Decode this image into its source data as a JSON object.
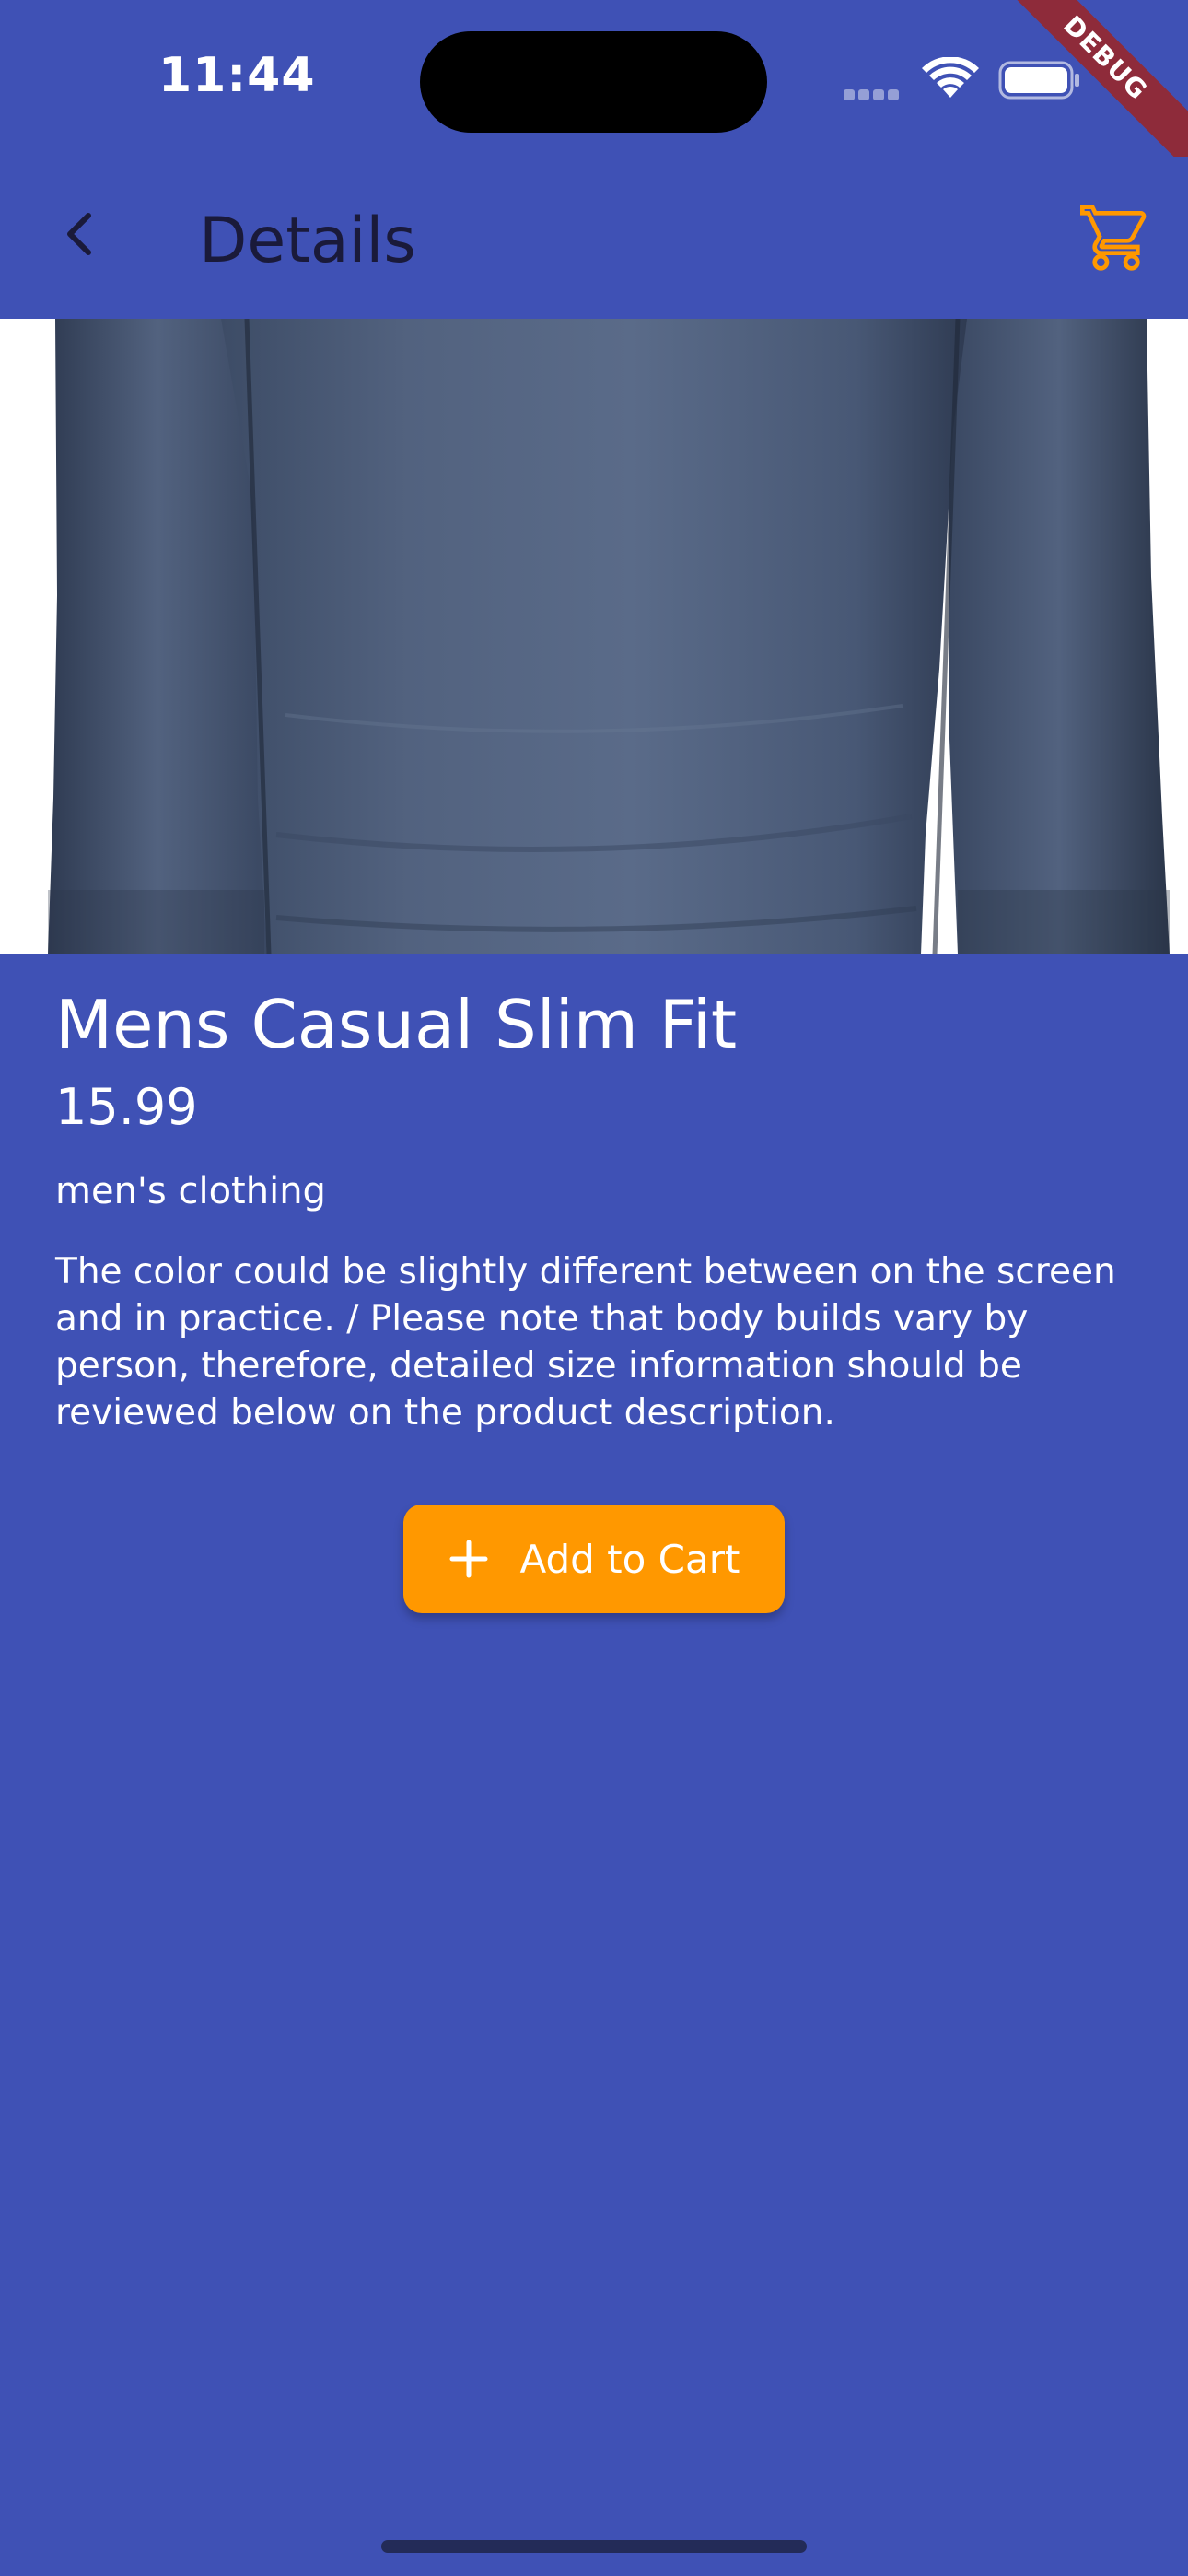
{
  "status_bar": {
    "time": "11:44",
    "debug_label": "DEBUG"
  },
  "app_bar": {
    "title": "Details",
    "back_icon": "chevron-left-icon",
    "cart_icon": "shopping-cart-icon"
  },
  "product": {
    "image_alt": "long-sleeve-shirt-photo",
    "title": "Mens Casual Slim Fit",
    "price": "15.99",
    "category": "men's clothing",
    "description": "The color could be slightly different between on the screen and in practice. / Please note that body builds vary by person, therefore, detailed size information should be reviewed below on the product description."
  },
  "actions": {
    "add_to_cart_label": "Add to Cart",
    "add_icon": "plus-icon"
  },
  "colors": {
    "background": "#3F51B5",
    "accent": "#FF9800",
    "title_text": "#1A1A3A"
  }
}
